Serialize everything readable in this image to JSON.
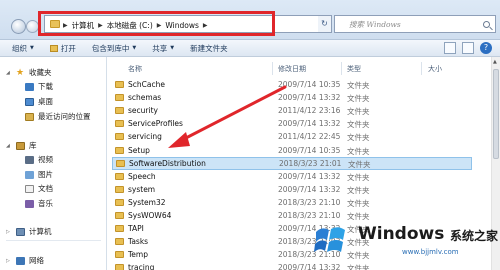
{
  "address_bar": {
    "breadcrumbs": [
      "计算机",
      "本地磁盘 (C:)",
      "Windows"
    ],
    "search_placeholder": "搜索 Windows"
  },
  "toolbar": {
    "organize_label": "组织",
    "open_label": "打开",
    "include_library_label": "包含到库中",
    "share_label": "共享",
    "new_folder_label": "新建文件夹"
  },
  "nav": {
    "favorites_label": "收藏夹",
    "favorites_items": [
      "下载",
      "桌面",
      "最近访问的位置"
    ],
    "libraries_label": "库",
    "libraries_items": [
      "视频",
      "图片",
      "文档",
      "音乐"
    ],
    "computer_label": "计算机",
    "network_label": "网络"
  },
  "columns": {
    "name": "名称",
    "date": "修改日期",
    "type": "类型",
    "size": "大小"
  },
  "files": [
    {
      "name": "SchCache",
      "date": "2009/7/14 10:35",
      "type": "文件夹"
    },
    {
      "name": "schemas",
      "date": "2009/7/14 13:32",
      "type": "文件夹"
    },
    {
      "name": "security",
      "date": "2011/4/12 23:16",
      "type": "文件夹"
    },
    {
      "name": "ServiceProfiles",
      "date": "2009/7/14 13:32",
      "type": "文件夹"
    },
    {
      "name": "servicing",
      "date": "2011/4/12 22:45",
      "type": "文件夹"
    },
    {
      "name": "Setup",
      "date": "2009/7/14 10:35",
      "type": "文件夹"
    },
    {
      "name": "SoftwareDistribution",
      "date": "2018/3/23 21:01",
      "type": "文件夹"
    },
    {
      "name": "Speech",
      "date": "2009/7/14 13:32",
      "type": "文件夹"
    },
    {
      "name": "system",
      "date": "2009/7/14 13:32",
      "type": "文件夹"
    },
    {
      "name": "System32",
      "date": "2018/3/23 21:10",
      "type": "文件夹"
    },
    {
      "name": "SysWOW64",
      "date": "2018/3/23 21:10",
      "type": "文件夹"
    },
    {
      "name": "TAPI",
      "date": "2009/7/14 13:32",
      "type": "文件夹"
    },
    {
      "name": "Tasks",
      "date": "2018/3/23 21:03",
      "type": "文件夹"
    },
    {
      "name": "Temp",
      "date": "2018/3/23 21:10",
      "type": "文件夹"
    },
    {
      "name": "tracing",
      "date": "2009/7/14 13:32",
      "type": "文件夹"
    }
  ],
  "selected_file_index": 6,
  "colors": {
    "highlight_frame": "#e0262b",
    "arrow": "#e0262b",
    "selection": "#cce4f7"
  },
  "watermark": {
    "brand": "Windows",
    "cn": "系统之家",
    "url": "www.bjjmlv.com"
  }
}
